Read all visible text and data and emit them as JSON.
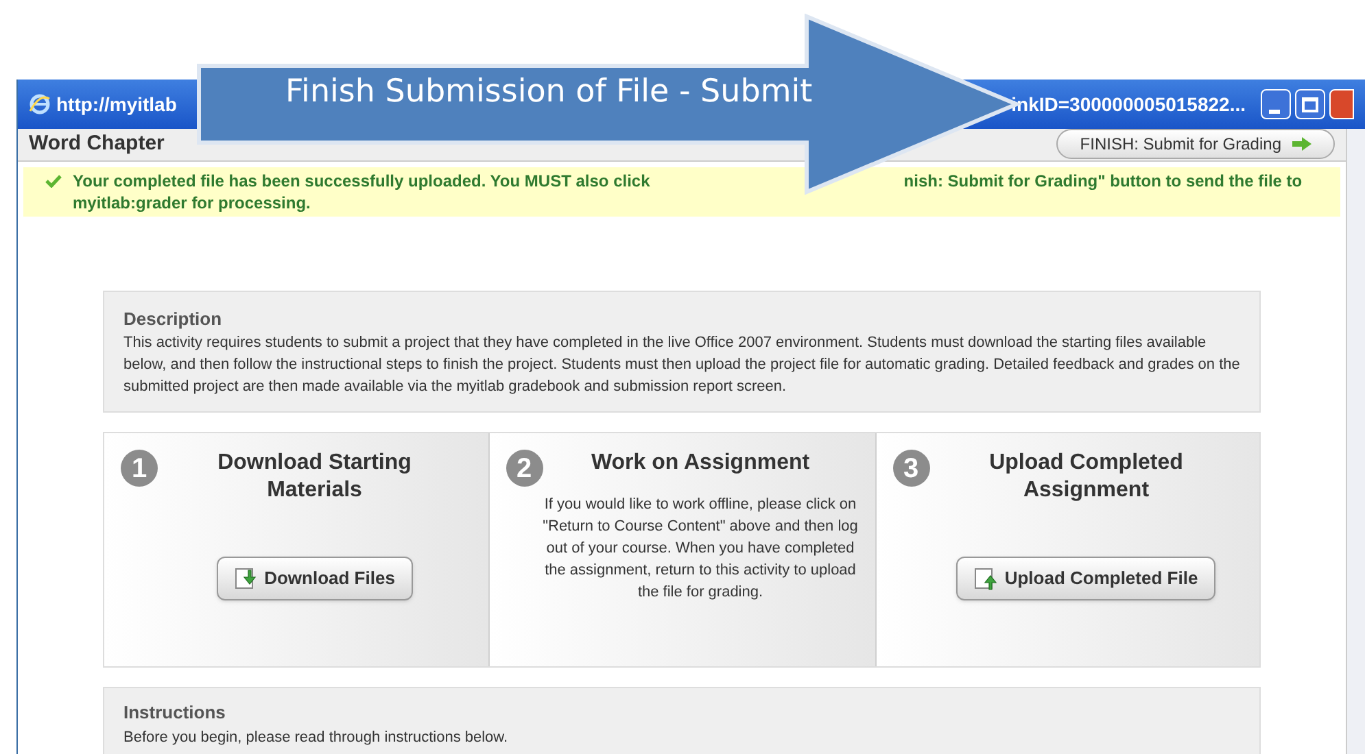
{
  "window": {
    "title_left": "http://myitlab",
    "title_right": "inkID=300000005015822..."
  },
  "toolbar": {
    "title": "Word Chapter",
    "finish_button": "FINISH: Submit for Grading"
  },
  "notice": "Your completed file has been successfully uploaded. You MUST also click",
  "notice_tail": "nish: Submit for Grading\" button to send the file to myitlab:grader for processing.",
  "description": {
    "heading": "Description",
    "text": "This activity requires students to submit a project that they have completed in the live Office 2007 environment. Students must download the starting files available below, and then follow the instructional steps to finish the project. Students must then upload the project file for automatic grading. Detailed feedback and grades on the submitted project are then made available via the myitlab gradebook and submission report screen."
  },
  "steps": [
    {
      "number": "1",
      "title": "Download Starting Materials",
      "kind": "download",
      "button": "Download Files"
    },
    {
      "number": "2",
      "title": "Work on Assignment",
      "kind": "text",
      "text": "If you would like to work offline, please click on \"Return to Course Content\" above and then log out of your course. When you have completed the assignment, return to this activity to upload the file for grading."
    },
    {
      "number": "3",
      "title": "Upload Completed Assignment",
      "kind": "upload",
      "button": "Upload Completed File"
    }
  ],
  "instructions": {
    "heading": "Instructions",
    "text": "Before you begin, please read through instructions below."
  },
  "callout": {
    "text": "Finish Submission of File - Submit"
  }
}
